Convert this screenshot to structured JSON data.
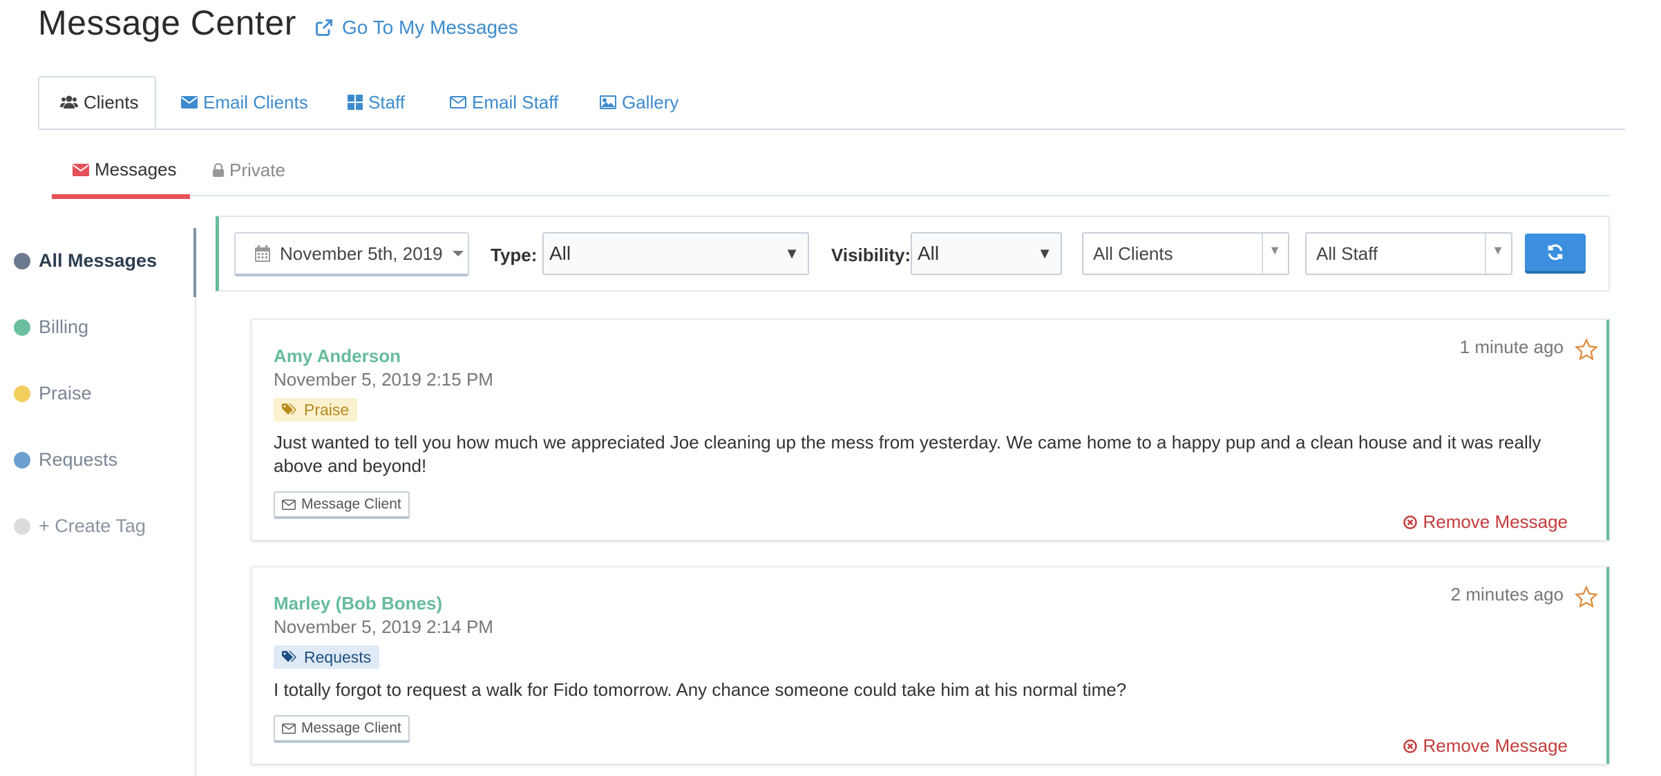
{
  "header": {
    "title": "Message Center",
    "go_link": "Go To My Messages"
  },
  "main_tabs": [
    {
      "label": "Clients",
      "icon": "users-icon"
    },
    {
      "label": "Email Clients",
      "icon": "envelope-icon"
    },
    {
      "label": "Staff",
      "icon": "grid-icon"
    },
    {
      "label": "Email Staff",
      "icon": "envelope-outline-icon"
    },
    {
      "label": "Gallery",
      "icon": "image-icon"
    }
  ],
  "sub_tabs": [
    {
      "label": "Messages",
      "icon": "envelope-icon"
    },
    {
      "label": "Private",
      "icon": "lock-icon"
    }
  ],
  "sidebar": {
    "items": [
      {
        "label": "All Messages",
        "color": "#6b7a8f"
      },
      {
        "label": "Billing",
        "color": "#6abf9e"
      },
      {
        "label": "Praise",
        "color": "#f1cf5c"
      },
      {
        "label": "Requests",
        "color": "#6a9fd0"
      },
      {
        "label": "+ Create Tag",
        "color": "#dcdcdc"
      }
    ]
  },
  "filters": {
    "date": "November 5th, 2019",
    "type_label": "Type:",
    "type_value": "All",
    "visibility_label": "Visibility:",
    "visibility_value": "All",
    "clients_value": "All Clients",
    "staff_value": "All Staff"
  },
  "messages": [
    {
      "sender": "Amy Anderson",
      "date": "November 5, 2019 2:15 PM",
      "tag": "Praise",
      "body": "Just wanted to tell you how much we appreciated Joe cleaning up the mess from yesterday. We came home to a happy pup and a clean house and it was really above and beyond!",
      "button": "Message Client",
      "time_ago": "1 minute ago",
      "remove": "Remove Message"
    },
    {
      "sender": "Marley (Bob Bones)",
      "date": "November 5, 2019 2:14 PM",
      "tag": "Requests",
      "body": "I totally forgot to request a walk for Fido tomorrow. Any chance someone could take him at his normal time?",
      "button": "Message Client",
      "time_ago": "2 minutes ago",
      "remove": "Remove Message"
    }
  ],
  "colors": {
    "link": "#3d8bcd",
    "accent_green": "#67bc9b",
    "active_tab_underline": "#e5515a",
    "refresh_button": "#3b8fde",
    "remove_red": "#c43c3c",
    "star_orange": "#e08a3c"
  }
}
